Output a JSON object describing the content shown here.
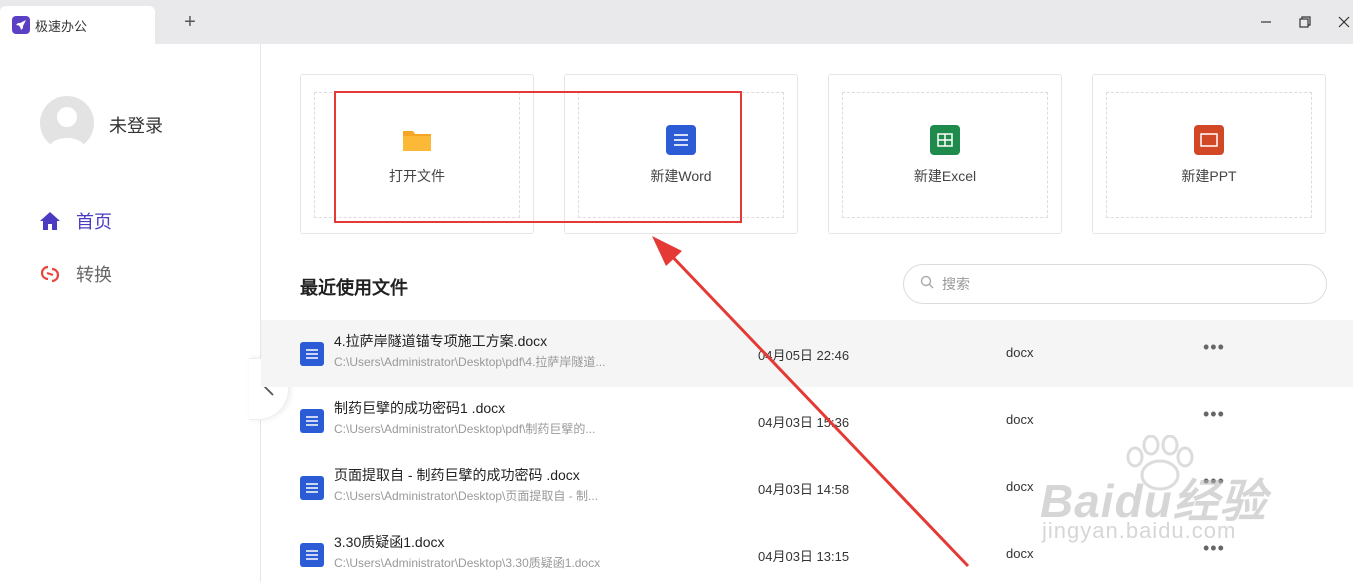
{
  "titlebar": {
    "tab_title": "极速办公",
    "new_tab": "+"
  },
  "sidebar": {
    "user_name": "未登录",
    "nav": [
      {
        "label": "首页",
        "icon": "home-icon",
        "active": true
      },
      {
        "label": "转换",
        "icon": "convert-icon",
        "active": false
      }
    ]
  },
  "cards": [
    {
      "label": "打开文件",
      "icon": "folder-icon",
      "color": "#f5a623"
    },
    {
      "label": "新建Word",
      "icon": "word-icon",
      "color": "#2b5cd6"
    },
    {
      "label": "新建Excel",
      "icon": "excel-icon",
      "color": "#1e8a4c"
    },
    {
      "label": "新建PPT",
      "icon": "ppt-icon",
      "color": "#d24726"
    }
  ],
  "recent": {
    "title": "最近使用文件",
    "search_placeholder": "搜索",
    "files": [
      {
        "name": "4.拉萨岸隧道锚专项施工方案.docx",
        "path": "C:\\Users\\Administrator\\Desktop\\pdf\\4.拉萨岸隧道...",
        "date": "04月05日 22:46",
        "type": "docx",
        "more": "•••"
      },
      {
        "name": "制药巨擘的成功密码1 .docx",
        "path": "C:\\Users\\Administrator\\Desktop\\pdf\\制药巨擘的...",
        "date": "04月03日 15:36",
        "type": "docx",
        "more": "•••"
      },
      {
        "name": "页面提取自 - 制药巨擘的成功密码 .docx",
        "path": "C:\\Users\\Administrator\\Desktop\\页面提取自 - 制...",
        "date": "04月03日 14:58",
        "type": "docx",
        "more": "•••"
      },
      {
        "name": "3.30质疑函1.docx",
        "path": "C:\\Users\\Administrator\\Desktop\\3.30质疑函1.docx",
        "date": "04月03日 13:15",
        "type": "docx",
        "more": "•••"
      }
    ]
  },
  "watermark": {
    "main": "Baidu经验",
    "sub": "jingyan.baidu.com"
  },
  "colors": {
    "accent": "#4a3bc2",
    "annotation": "#e53935"
  }
}
